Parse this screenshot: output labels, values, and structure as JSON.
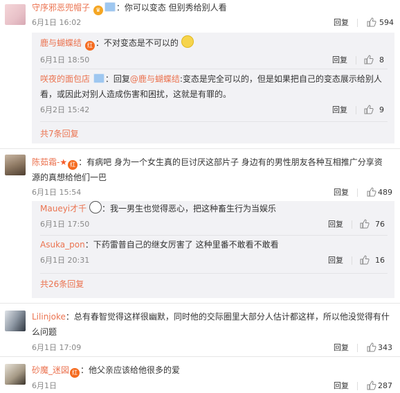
{
  "comments": [
    {
      "user": "守序邪恶兜帽子",
      "text": "你可以变态 但别秀给别人看",
      "time": "6月1日 16:02",
      "reply_label": "回复",
      "likes": "594",
      "replies": [
        {
          "user": "鹿与蝴蝶结",
          "text": "不对变态是不可以的",
          "time": "6月1日 18:50",
          "reply_label": "回复",
          "likes": "8"
        },
        {
          "user": "咲夜的面包店",
          "prefix": "回复",
          "mention": "@鹿与蝴蝶结",
          "text1": ":变态是完全可以的，但是如果把自己的变态展示给别人",
          "text2": "看，或因此对别人造成伤害和困扰，这就是有罪的。",
          "time": "6月2日 15:42",
          "reply_label": "回复",
          "likes": "9"
        }
      ],
      "more": "共7条回复"
    },
    {
      "user": "陈茹霜-",
      "text1": "有病吧 身为一个女生真的巨讨厌这部片子 身边有的男性朋友各种互相推广分享资",
      "text2": "源的真想给他们一巴",
      "time": "6月1日 15:54",
      "reply_label": "回复",
      "likes": "489",
      "replies": [
        {
          "user": "Maueyi才千",
          "text": "我一男生也觉得恶心，把这种畜生行为当娱乐",
          "time": "6月1日 17:50",
          "reply_label": "回复",
          "likes": "76"
        },
        {
          "user": "Asuka_pon",
          "text": "下药雷普自己的继女厉害了 这种里番不敢看不敢看",
          "time": "6月1日 20:31",
          "reply_label": "回复",
          "likes": "16"
        }
      ],
      "more": "共26条回复"
    },
    {
      "user": "Lilinjoke",
      "text1": "总有春智觉得这样很幽默，同时他的交际圈里大部分人估计都这样，所以他没觉得有什",
      "text2": "么问题",
      "time": "6月1日 17:09",
      "reply_label": "回复",
      "likes": "343"
    },
    {
      "user": "砂魔_迷図",
      "text": "他父亲应该给他很多的爱",
      "time": "6月1日",
      "reply_label": "回复",
      "likes": "287"
    }
  ],
  "colors": {
    "name": "#eb7350",
    "reply_bg": "#f2f2f5",
    "text": "#333333",
    "meta": "#888888"
  },
  "icons": {
    "like": "thumbs-up-icon",
    "badge": "vip-badge-icon"
  }
}
